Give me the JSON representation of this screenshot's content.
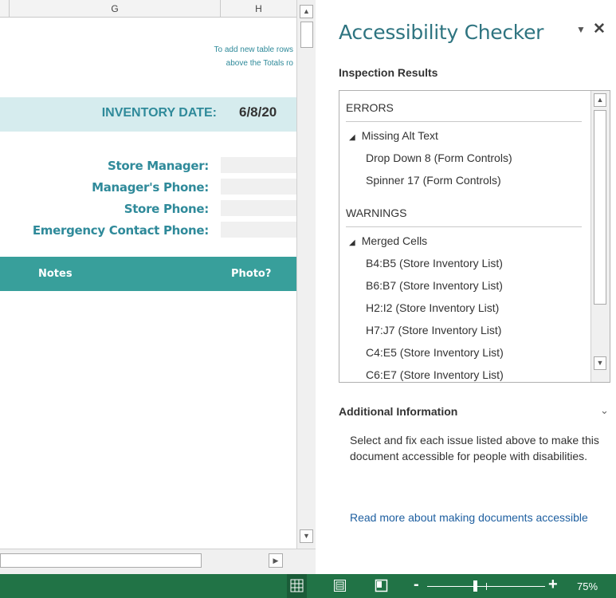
{
  "sheet": {
    "columns": [
      "G",
      "H"
    ],
    "note_line1": "To add new table rows",
    "note_line2": "above  the Totals ro",
    "inventory_date_label": "INVENTORY DATE:",
    "inventory_date_value": "6/8/20",
    "fields": {
      "store_manager": "Store Manager:",
      "manager_phone": "Manager's Phone:",
      "store_phone": "Store Phone:",
      "emergency_phone": "Emergency Contact Phone:"
    },
    "table_headers": {
      "notes": "Notes",
      "photo": "Photo?"
    },
    "band_color": "#d6ecee",
    "header_color": "#389f9b"
  },
  "pane": {
    "title": "Accessibility Checker",
    "inspection_results_label": "Inspection Results",
    "errors_label": "ERRORS",
    "errors_group": "Missing Alt Text",
    "errors_items": [
      "Drop Down 8 (Form Controls)",
      "Spinner 17 (Form Controls)"
    ],
    "warnings_label": "WARNINGS",
    "warnings_group": "Merged Cells",
    "warnings_items": [
      "B4:B5 (Store Inventory List)",
      "B6:B7 (Store Inventory List)",
      "H2:I2 (Store Inventory List)",
      "H7:J7 (Store Inventory List)",
      "C4:E5 (Store Inventory List)",
      "C6:E7 (Store Inventory List)"
    ],
    "additional_info_label": "Additional Information",
    "additional_info_text": "Select and fix each issue listed above to make this document accessible for people with disabilities.",
    "read_more_link": "Read more about making documents accessible",
    "accent_color": "#2e7480"
  },
  "statusbar": {
    "zoom_level": "75%",
    "zoom_fraction": 0.4,
    "bar_color": "#217346"
  },
  "icons": {
    "pane_menu": "dropdown-triangle-icon",
    "pane_close": "close-icon",
    "expand": "chevron-down-icon",
    "collapse_group": "triangle-collapse-icon",
    "normal_view": "grid-icon",
    "page_layout_view": "page-layout-icon",
    "page_break_view": "page-break-icon"
  }
}
